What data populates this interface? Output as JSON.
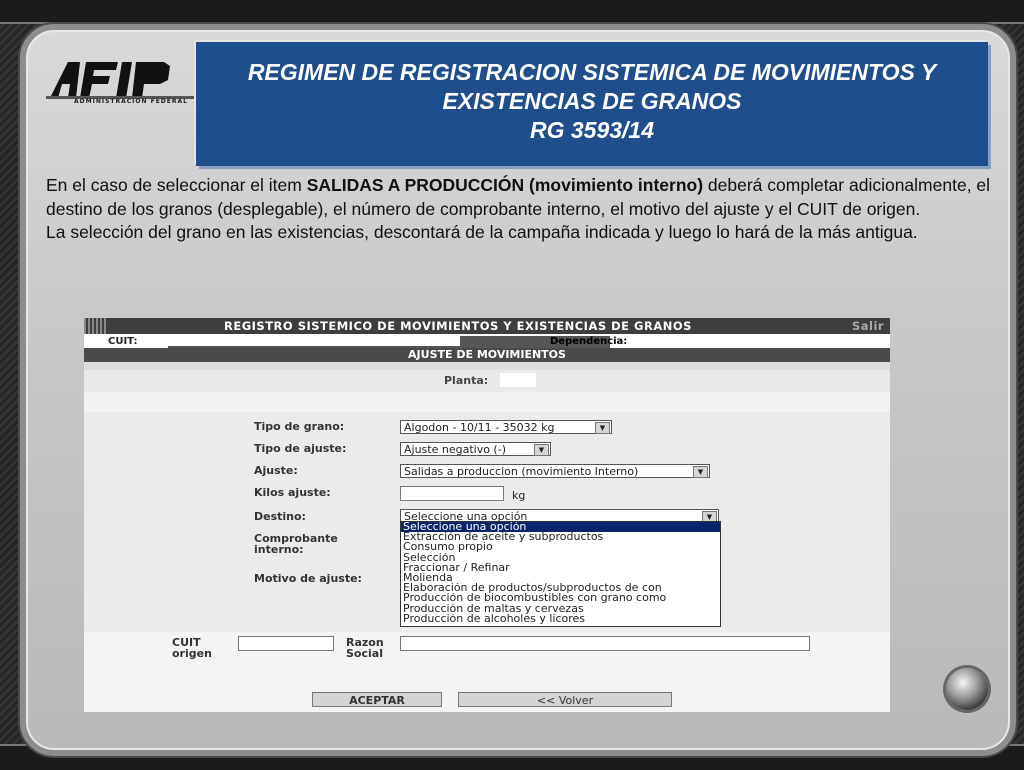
{
  "slide": {
    "title_lines": [
      "REGIMEN DE REGISTRACION SISTEMICA DE MOVIMIENTOS Y",
      "EXISTENCIAS DE GRANOS",
      "RG  3593/14"
    ],
    "logo_text": "AFIP",
    "logo_subtitle": "ADMINISTRACION FEDERAL",
    "paragraph1_pre": "En el caso de seleccionar el item ",
    "paragraph1_bold": "SALIDAS A PRODUCCIÓN (movimiento interno)",
    "paragraph1_post": " deberá completar adicionalmente, el destino de los granos (desplegable), el número de comprobante interno, el motivo del ajuste y el CUIT de origen.",
    "paragraph2": "La selección del grano en las existencias,  descontará de la campaña indicada y luego  lo hará de la más antigua."
  },
  "screenshot": {
    "header_title": "REGISTRO SISTEMICO DE MOVIMIENTOS Y EXISTENCIAS DE GRANOS",
    "salir": "Salir",
    "cuit_label": "CUIT:",
    "dependencia_label": "Dependencia:",
    "section_title": "AJUSTE DE MOVIMIENTOS",
    "planta_label": "Planta:",
    "fields": {
      "tipo_grano_label": "Tipo de grano:",
      "tipo_grano_value": "Algodon - 10/11 - 35032 kg",
      "tipo_ajuste_label": "Tipo de ajuste:",
      "tipo_ajuste_value": "Ajuste negativo (-)",
      "ajuste_label": "Ajuste:",
      "ajuste_value": "Salidas a produccion (movimiento Interno)",
      "kilos_label": "Kilos ajuste:",
      "kilos_unit": "kg",
      "destino_label": "Destino:",
      "destino_value": "Seleccione una opción",
      "comprobante_label_1": "Comprobante",
      "comprobante_label_2": "interno:",
      "motivo_label": "Motivo de ajuste:",
      "cuit_origen_label_1": "CUIT",
      "cuit_origen_label_2": "origen",
      "razon_label_1": "Razon",
      "razon_label_2": "Social"
    },
    "destino_options": [
      "Seleccione una opción",
      "Extracción de aceite y subproductos",
      "Consumo propio",
      "Selección",
      "Fraccionar / Refinar",
      "Molienda",
      "Elaboración de productos/subproductos de con",
      "Producción de biocombustibles con grano como",
      "Producción de maltas y cervezas",
      "Producción de alcoholes y licores"
    ],
    "buttons": {
      "aceptar": "ACEPTAR",
      "volver": "<< Volver"
    }
  },
  "colors": {
    "title_bg": "#1f4e8c",
    "dropdown_highlight": "#0a246a"
  }
}
